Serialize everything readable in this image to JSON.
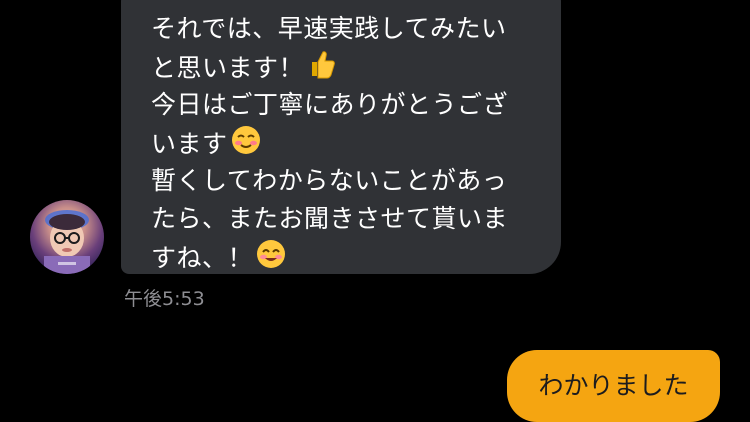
{
  "chat": {
    "incoming_message": {
      "lines": [
        "それでは、早速実践してみたい",
        "と思います！",
        "今日はご丁寧にありがとうござ",
        "います",
        "暫くしてわからないことがあっ",
        "たら、またお聞きさせて貰いま",
        "すね、！"
      ],
      "timestamp": "午後5:53",
      "emojis": [
        "thumbs-up-icon",
        "smiling-blush-icon",
        "smiling-face-icon"
      ]
    },
    "outgoing_message": {
      "text": "わかりました"
    },
    "colors": {
      "background": "#000000",
      "incoming_bubble": "#303236",
      "outgoing_bubble": "#f5a511",
      "timestamp": "#8e8e93"
    }
  }
}
